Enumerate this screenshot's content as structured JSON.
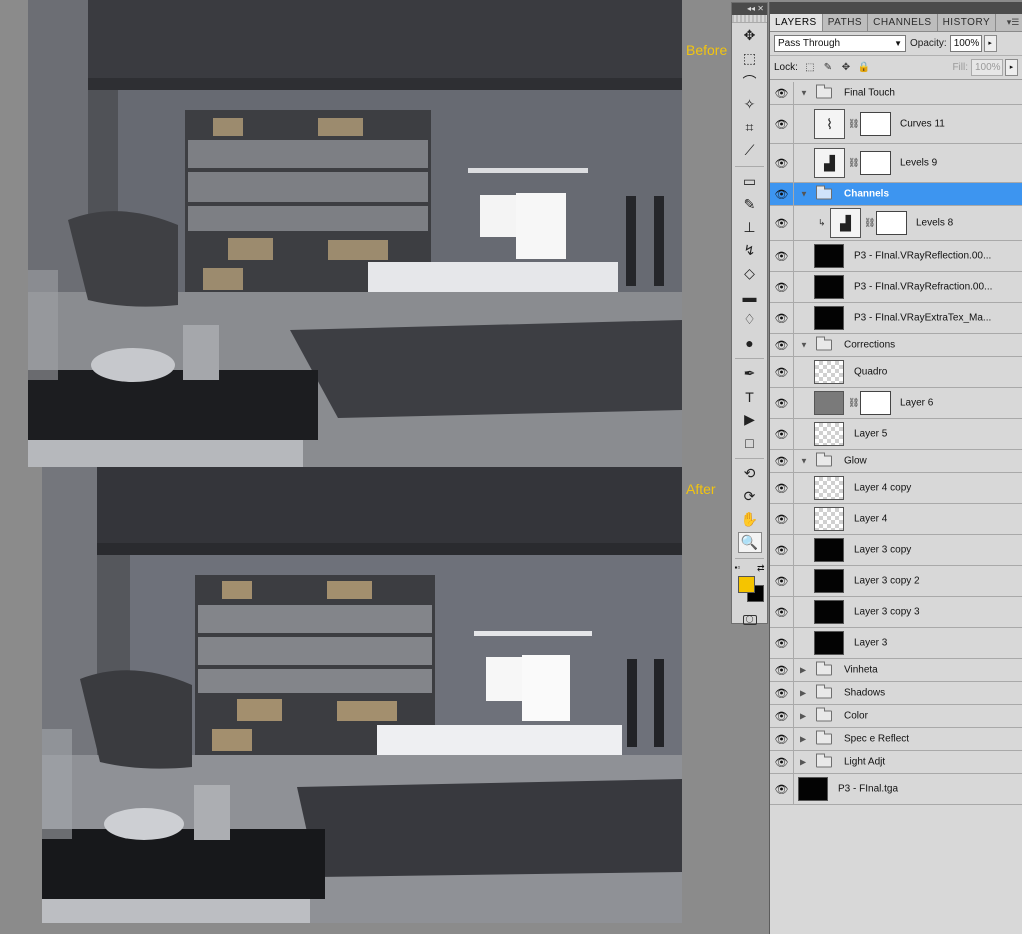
{
  "labels": {
    "before": "Before",
    "after": "After"
  },
  "toolbar": {
    "collapse": "◂◂ ✕",
    "tools": [
      {
        "name": "move-tool",
        "glyph": "✥"
      },
      {
        "name": "marquee-tool",
        "glyph": "⬚"
      },
      {
        "name": "lasso-tool",
        "glyph": "⌒"
      },
      {
        "name": "magic-wand-tool",
        "glyph": "✧"
      },
      {
        "name": "crop-tool",
        "glyph": "⌗"
      },
      {
        "name": "eyedropper-tool",
        "glyph": "⟋"
      },
      {
        "name": "healing-brush-tool",
        "glyph": "▭"
      },
      {
        "name": "brush-tool",
        "glyph": "✎"
      },
      {
        "name": "clone-stamp-tool",
        "glyph": "⊥"
      },
      {
        "name": "history-brush-tool",
        "glyph": "↯"
      },
      {
        "name": "eraser-tool",
        "glyph": "◇"
      },
      {
        "name": "gradient-tool",
        "glyph": "▬"
      },
      {
        "name": "blur-tool",
        "glyph": "♢"
      },
      {
        "name": "dodge-tool",
        "glyph": "●"
      },
      {
        "name": "pen-tool",
        "glyph": "✒"
      },
      {
        "name": "type-tool",
        "glyph": "T"
      },
      {
        "name": "path-selection-tool",
        "glyph": "▶"
      },
      {
        "name": "shape-tool",
        "glyph": "□"
      },
      {
        "name": "3d-rotate-tool",
        "glyph": "⟲"
      },
      {
        "name": "3d-orbit-tool",
        "glyph": "⟳"
      },
      {
        "name": "hand-tool",
        "glyph": "✋"
      },
      {
        "name": "zoom-tool",
        "glyph": "🔍"
      }
    ],
    "foreground_color": "#f5c400",
    "background_color": "#000000"
  },
  "panel": {
    "tabs": [
      "LAYERS",
      "PATHS",
      "CHANNELS",
      "HISTORY"
    ],
    "active_tab": "LAYERS",
    "blend_mode": "Pass Through",
    "opacity_label": "Opacity:",
    "opacity": "100%",
    "lock_label": "Lock:",
    "fill_label": "Fill:",
    "fill": "100%",
    "layers": [
      {
        "name": "Final Touch",
        "kind": "group",
        "expanded": true,
        "indent": 0
      },
      {
        "name": "Curves 11",
        "kind": "adjust",
        "icon": "curves",
        "indent": 1
      },
      {
        "name": "Levels 9",
        "kind": "adjust",
        "icon": "levels",
        "indent": 1
      },
      {
        "name": "Channels",
        "kind": "group",
        "expanded": true,
        "indent": 1,
        "selected": true
      },
      {
        "name": "Levels 8",
        "kind": "adjust",
        "icon": "levels",
        "indent": 2,
        "clipped": true
      },
      {
        "name": "P3 - FInal.VRayReflection.00...",
        "kind": "pixel",
        "thumb": "black",
        "indent": 1
      },
      {
        "name": "P3 - FInal.VRayRefraction.00...",
        "kind": "pixel",
        "thumb": "black",
        "indent": 1
      },
      {
        "name": "P3 - FInal.VRayExtraTex_Ma...",
        "kind": "pixel",
        "thumb": "black",
        "indent": 1
      },
      {
        "name": "Corrections",
        "kind": "group",
        "expanded": true,
        "indent": 0
      },
      {
        "name": "Quadro",
        "kind": "pixel",
        "thumb": "trans",
        "indent": 1
      },
      {
        "name": "Layer 6",
        "kind": "masked",
        "thumb": "gray",
        "indent": 1
      },
      {
        "name": "Layer 5",
        "kind": "pixel",
        "thumb": "trans",
        "indent": 1
      },
      {
        "name": "Glow",
        "kind": "group",
        "expanded": true,
        "indent": 0
      },
      {
        "name": "Layer 4 copy",
        "kind": "pixel",
        "thumb": "trans",
        "indent": 1
      },
      {
        "name": "Layer 4",
        "kind": "pixel",
        "thumb": "trans",
        "indent": 1
      },
      {
        "name": "Layer 3 copy",
        "kind": "pixel",
        "thumb": "black",
        "indent": 1
      },
      {
        "name": "Layer 3 copy 2",
        "kind": "pixel",
        "thumb": "black",
        "indent": 1
      },
      {
        "name": "Layer 3 copy 3",
        "kind": "pixel",
        "thumb": "black",
        "indent": 1
      },
      {
        "name": "Layer 3",
        "kind": "pixel",
        "thumb": "black",
        "indent": 1
      },
      {
        "name": "Vinheta",
        "kind": "group",
        "expanded": false,
        "indent": 0
      },
      {
        "name": "Shadows",
        "kind": "group",
        "expanded": false,
        "indent": 0
      },
      {
        "name": "Color",
        "kind": "group",
        "expanded": false,
        "indent": 0
      },
      {
        "name": "Spec e Reflect",
        "kind": "group",
        "expanded": false,
        "indent": 0
      },
      {
        "name": "Light Adjt",
        "kind": "group",
        "expanded": false,
        "indent": 0
      },
      {
        "name": "P3 - FInal.tga",
        "kind": "pixel",
        "thumb": "black",
        "indent": 0
      }
    ]
  }
}
